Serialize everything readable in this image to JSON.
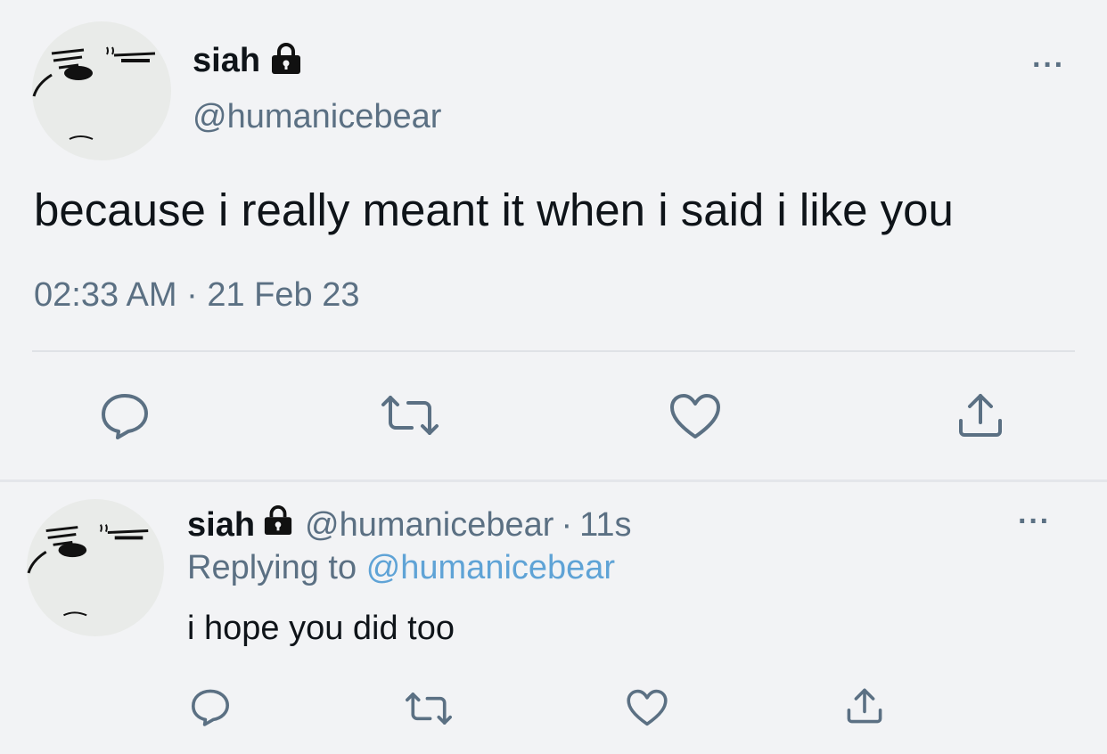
{
  "main_tweet": {
    "display_name": "siah",
    "handle": "@humanicebear",
    "text": "because i really meant it when i said i like you",
    "time": "02:33 AM",
    "separator": "·",
    "date": "21 Feb 23",
    "more": "···"
  },
  "reply_tweet": {
    "display_name": "siah",
    "handle": "@humanicebear",
    "separator": "·",
    "age": "11s",
    "replying_prefix": "Replying to",
    "replying_handle": "@humanicebear",
    "text": "i hope you did too",
    "more": "···"
  },
  "icons": {
    "reply": "reply-icon",
    "retweet": "retweet-icon",
    "like": "heart-icon",
    "share": "share-icon",
    "lock": "lock-icon",
    "more": "more-icon"
  },
  "colors": {
    "background": "#f2f3f5",
    "text": "#0f1419",
    "secondary": "#5b7083",
    "link": "#5fa3d6",
    "divider": "#dfe2e6"
  }
}
